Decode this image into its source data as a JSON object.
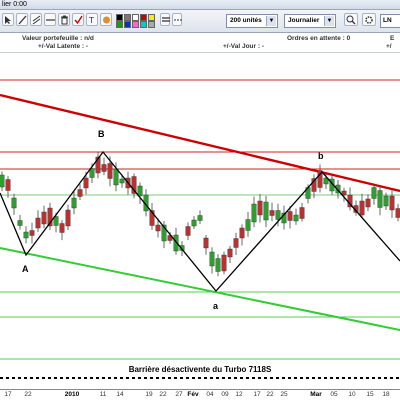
{
  "window": {
    "title": "lier  0:00"
  },
  "toolbar": {
    "palette_colors": [
      "#000000",
      "#777777",
      "#ffffff",
      "#cc0000",
      "#ffee00",
      "#00aa00",
      "#0033cc",
      "#ff66cc",
      "#00cccc",
      "#aaaaaa"
    ],
    "units_select": "200 unités",
    "period_select": "Journalier",
    "right_button": "LN"
  },
  "info": {
    "portfolio": "Valeur portefeuille : n/d",
    "latent": "+/-Val Latente : -",
    "pending": "Ordres en attente : 0",
    "daily": "+/-Val Jour : -",
    "right_a": "E",
    "right_b": "+/"
  },
  "chart": {
    "point_labels": {
      "A": "A",
      "B": "B",
      "a": "a",
      "b": "b"
    },
    "barrier_text": "Barrière désactivente du Turbo 7118S",
    "colors": {
      "resistance": "#cc0000",
      "support": "#33cc33",
      "zigzag": "#000000",
      "up": "#2e9e2e",
      "down": "#b83232",
      "dotted": "#000000"
    }
  },
  "axis": {
    "labels": [
      "17",
      "22",
      "2010",
      "11",
      "14",
      "19",
      "22",
      "27",
      "Fév",
      "04",
      "09",
      "12",
      "17",
      "22",
      "25",
      "Mar",
      "05",
      "10",
      "15",
      "18"
    ]
  }
}
